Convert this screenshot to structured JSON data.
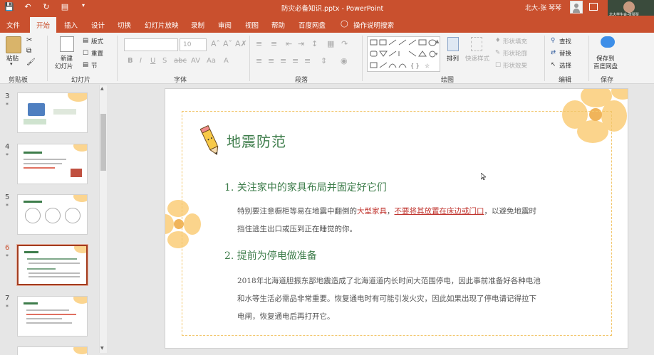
{
  "window": {
    "title": "防灾必备知识.pptx - PowerPoint",
    "user": "北大-张 琴琴",
    "webcam_caption": "北大学生会-张琴琴"
  },
  "tabs": [
    "文件",
    "开始",
    "插入",
    "设计",
    "切换",
    "幻灯片放映",
    "录制",
    "审阅",
    "视图",
    "帮助",
    "百度网盘",
    "操作说明搜索"
  ],
  "active_tab": "开始",
  "ribbon": {
    "clipboard": {
      "label": "剪贴板",
      "paste": "粘贴"
    },
    "slides": {
      "label": "幻灯片",
      "new_slide_1": "新建",
      "new_slide_2": "幻灯片",
      "layout": "版式",
      "reset": "重置",
      "section": "节"
    },
    "font": {
      "label": "字体",
      "font_size": "10"
    },
    "paragraph": {
      "label": "段落"
    },
    "drawing": {
      "label": "绘图",
      "arrange": "排列",
      "quick_styles": "快速样式",
      "shape_fill": "形状填充",
      "shape_outline": "形状轮廓",
      "shape_effects": "形状效果"
    },
    "editing": {
      "label": "编辑",
      "find": "查找",
      "replace": "替换",
      "select": "选择"
    },
    "save": {
      "label": "保存",
      "save_to_1": "保存到",
      "save_to_2": "百度网盘"
    }
  },
  "thumbnails": [
    {
      "num": "3",
      "star": "*",
      "selected": false
    },
    {
      "num": "4",
      "star": "*",
      "selected": false
    },
    {
      "num": "5",
      "star": "*",
      "selected": false
    },
    {
      "num": "6",
      "star": "*",
      "selected": true
    },
    {
      "num": "7",
      "star": "*",
      "selected": false
    }
  ],
  "slide": {
    "title": "地震防范",
    "h1": "1. 关注家中的家具布局并固定好它们",
    "p1_a": "特别要注意橱柜等易在地震中翻倒的",
    "p1_b": "大型家具",
    "p1_c": "，",
    "p1_d": "不要将其放置在床边或门口",
    "p1_e": "，以避免地震时",
    "p1_f": "挡住逃生出口或压到正在睡觉的你。",
    "h2": "2. 提前为停电做准备",
    "p2_1": "2018年北海道胆振东部地震造成了北海道道内长时间大范围停电，因此事前准备好各种电池",
    "p2_2": "和水等生活必需品非常重要。恢复通电时有可能引发火灾，因此如果出现了停电请记得拉下",
    "p2_3": "电闸，恢复通电后再打开它。"
  },
  "colors": {
    "accent": "#c9502e",
    "heading": "#3e7d4b",
    "emphasis": "#c0342e",
    "border": "#f2c66b"
  }
}
